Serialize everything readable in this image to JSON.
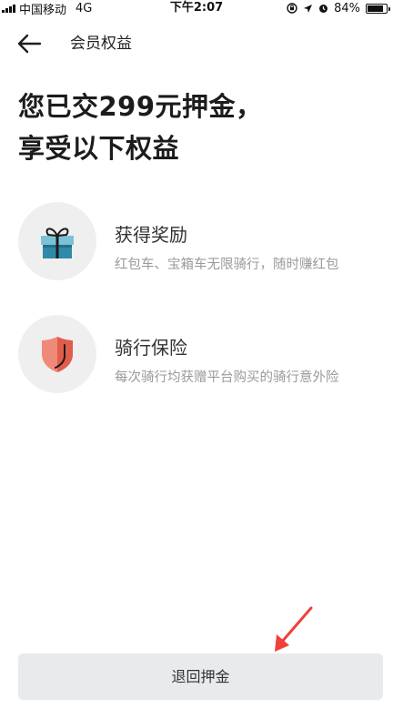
{
  "status_bar": {
    "carrier": "中国移动",
    "network": "4G",
    "time": "下午2:07",
    "battery": "84%",
    "battery_level": 0.84
  },
  "nav": {
    "title": "会员权益"
  },
  "headline": {
    "line1": "您已交299元押金，",
    "line2": "享受以下权益"
  },
  "benefits": [
    {
      "icon": "gift-icon",
      "title": "获得奖励",
      "desc": "红包车、宝箱车无限骑行，随时赚红包"
    },
    {
      "icon": "shield-icon",
      "title": "骑行保险",
      "desc": "每次骑行均获赠平台购买的骑行意外险"
    }
  ],
  "footer": {
    "refund_label": "退回押金"
  },
  "colors": {
    "accent_red": "#f0403a",
    "button_bg": "#e8eaec",
    "gift_blue": "#2f8aa8",
    "shield_salmon": "#f08a78"
  }
}
